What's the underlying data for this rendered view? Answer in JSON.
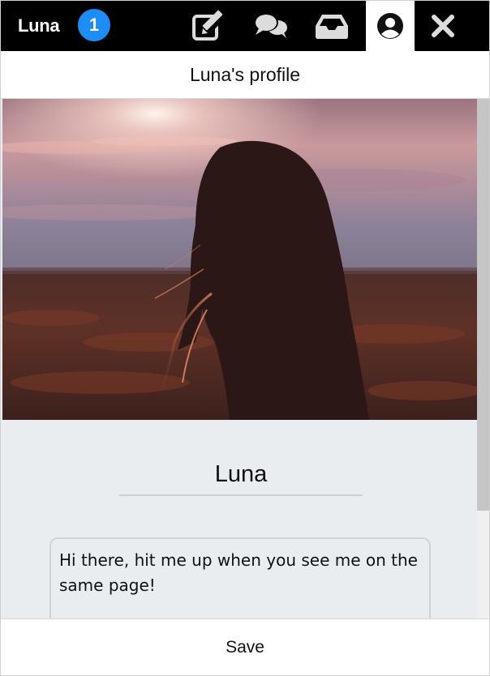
{
  "topbar": {
    "user_name": "Luna",
    "notification_count": "1",
    "nav_icons": [
      "compose-icon",
      "chat-icon",
      "inbox-icon",
      "profile-icon",
      "close-icon"
    ],
    "active_nav": "profile-icon"
  },
  "header": {
    "title": "Luna's profile"
  },
  "profile": {
    "photo_alt": "Luna",
    "name_value": "Luna",
    "bio_value": "Hi there, hit me up when you see me on the same page!"
  },
  "footer": {
    "save_label": "Save"
  },
  "colors": {
    "topbar_bg": "#000000",
    "badge_bg": "#1d8ef5",
    "content_bg": "#eaedf0"
  }
}
